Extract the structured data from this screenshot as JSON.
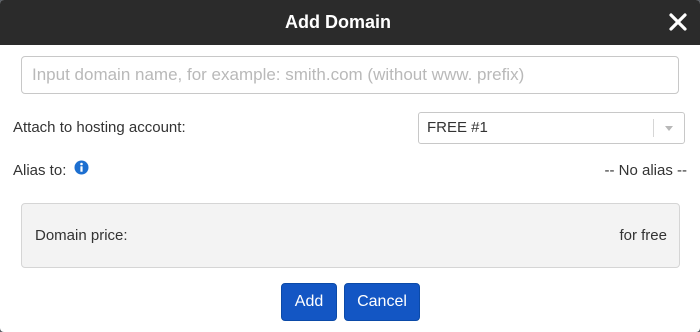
{
  "dialog": {
    "title": "Add Domain",
    "close_icon": "close-icon"
  },
  "domain_input": {
    "value": "",
    "placeholder": "Input domain name, for example: smith.com (without www. prefix)"
  },
  "hosting": {
    "label": "Attach to hosting account:",
    "selected": "FREE #1",
    "dropdown_icon": "chevron-down-icon"
  },
  "alias": {
    "label": "Alias to:",
    "info_icon": "info-icon",
    "value": "-- No alias --"
  },
  "price": {
    "label": "Domain price:",
    "value": "for free"
  },
  "buttons": {
    "add": "Add",
    "cancel": "Cancel"
  },
  "colors": {
    "header_bg": "#2b2b2b",
    "button_bg": "#1356c4",
    "info_icon": "#1d6fd0",
    "price_box_bg": "#f3f3f3"
  }
}
